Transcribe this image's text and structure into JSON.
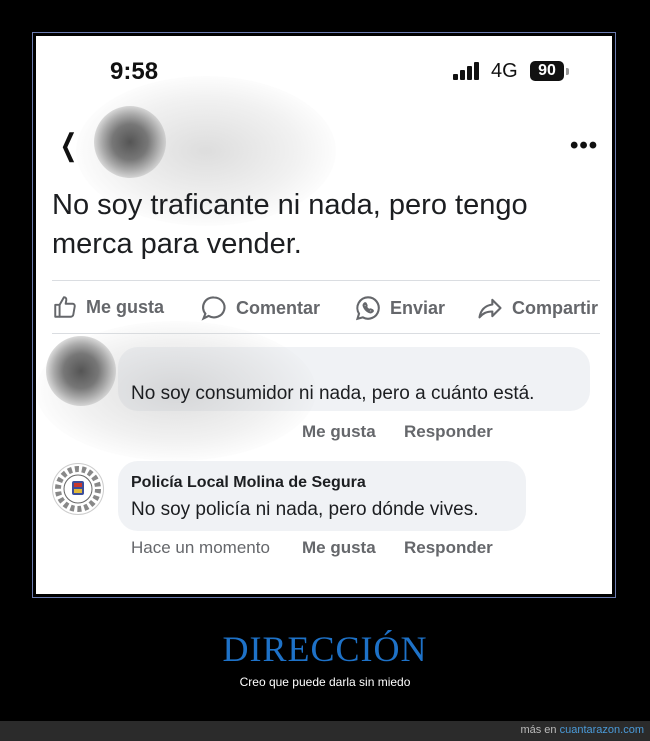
{
  "status_bar": {
    "time": "9:58",
    "network": "4G",
    "battery": "90"
  },
  "post": {
    "text": "No soy traficante ni nada, pero tengo merca para vender."
  },
  "actions": {
    "like": "Me gusta",
    "comment": "Comentar",
    "send": "Enviar",
    "share": "Compartir"
  },
  "comments": [
    {
      "author": "",
      "text": "No soy consumidor ni nada, pero a cuánto está.",
      "like": "Me gusta",
      "reply": "Responder"
    },
    {
      "author": "Policía Local Molina de Segura",
      "text": "No soy policía ni nada, pero dónde vives.",
      "time": "Hace un momento",
      "like": "Me gusta",
      "reply": "Responder"
    }
  ],
  "caption": {
    "title": "DIRECCIÓN",
    "subtitle": "Creo que puede darla sin miedo"
  },
  "footer": {
    "prefix": "más en",
    "site": "cuantarazon.com"
  },
  "colors": {
    "accent": "#1e72c8",
    "bubble": "#f0f2f5",
    "meta": "#65676b"
  },
  "icons": [
    "back-icon",
    "more-icon",
    "like-icon",
    "comment-icon",
    "whatsapp-icon",
    "share-icon"
  ]
}
